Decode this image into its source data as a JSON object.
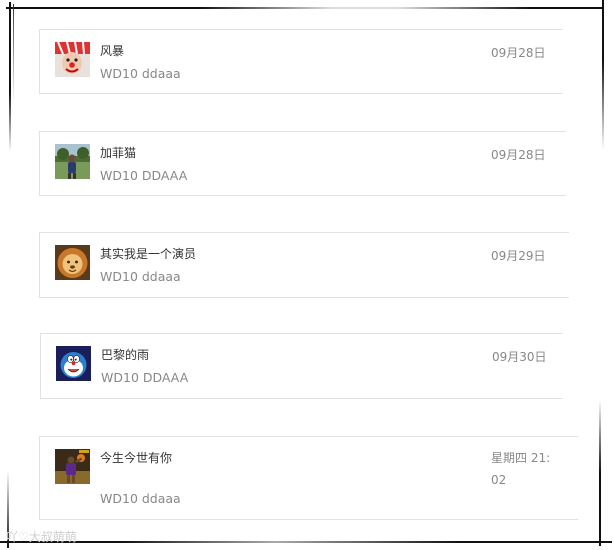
{
  "conversations": [
    {
      "name": "风暴",
      "message": "WD10 ddaaa",
      "time": "09月28日",
      "avatar": "clown-avatar"
    },
    {
      "name": "加菲猫",
      "message": "WD10 DDAAA",
      "time": "09月28日",
      "avatar": "outdoor-person-avatar"
    },
    {
      "name": "其实我是一个演员",
      "message": "WD10 ddaaa",
      "time": "09月29日",
      "avatar": "lion-avatar"
    },
    {
      "name": "巴黎的雨",
      "message": "WD10 DDAAA",
      "time": "09月30日",
      "avatar": "doraemon-avatar"
    },
    {
      "name": "今生今世有你",
      "message": "WD10 ddaaa",
      "time": "星期四 21:02",
      "avatar": "basketball-player-avatar"
    }
  ],
  "watermark": "吖♡大叔萌萌"
}
